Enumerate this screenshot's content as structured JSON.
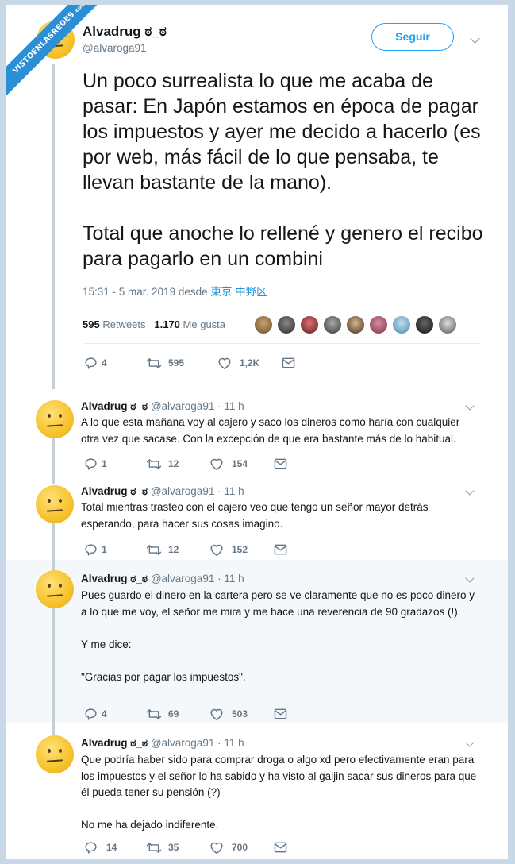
{
  "watermark": {
    "text": "VISTOENLASREDES",
    "suffix": ".com"
  },
  "main": {
    "name": "Alvadrug ಠ_ಠ",
    "handle": "@alvaroga91",
    "follow_label": "Seguir",
    "text": "Un poco surrealista lo que me acaba de pasar: En Japón estamos en época de pagar los impuestos y ayer me decido a hacerlo (es por web, más fácil de lo que pensaba, te llevan bastante de la mano).\n\nTotal que anoche lo rellené y genero el recibo para pagarlo en un combini",
    "time": "15:31 - 5 mar. 2019 desde",
    "location": "東京 中野区",
    "retweets_count": "595",
    "retweets_label": "Retweets",
    "likes_count": "1.170",
    "likes_label": "Me gusta",
    "actions": {
      "replies": "4",
      "retweets": "595",
      "likes": "1,2K"
    }
  },
  "replies": [
    {
      "name": "Alvadrug ಠ_ಠ",
      "handle": "@alvaroga91",
      "time": "· 11 h",
      "text": "A lo que esta mañana voy al cajero y saco los dineros como haría con cualquier otra vez que sacase. Con la excepción de que era bastante más de lo habitual.",
      "replies": "1",
      "retweets": "12",
      "likes": "154"
    },
    {
      "name": "Alvadrug ಠ_ಠ",
      "handle": "@alvaroga91",
      "time": "· 11 h",
      "text": "Total mientras trasteo con el cajero veo que tengo un señor mayor detrás esperando, para hacer sus cosas imagino.",
      "replies": "1",
      "retweets": "12",
      "likes": "152"
    },
    {
      "name": "Alvadrug ಠ_ಠ",
      "handle": "@alvaroga91",
      "time": "· 11 h",
      "text": "Pues guardo el dinero en la cartera pero se ve claramente que no es poco dinero y a lo que me voy, el señor me mira y me hace una reverencia de 90 gradazos (!).\n\nY me dice:\n\n\"Gracias por pagar los impuestos\".",
      "replies": "4",
      "retweets": "69",
      "likes": "503"
    },
    {
      "name": "Alvadrug ಠ_ಠ",
      "handle": "@alvaroga91",
      "time": "· 11 h",
      "text": "Que podría haber sido para comprar droga o algo xd pero efectivamente eran para los impuestos y el señor lo ha sabido y ha visto al gaijin sacar sus dineros para que él pueda tener su pensión (?)\n\nNo me ha dejado indiferente.",
      "replies": "14",
      "retweets": "35",
      "likes": "700"
    }
  ],
  "colors": {
    "accent": "#1da1f2",
    "muted": "#657786",
    "text": "#14171a",
    "highlight": "#f5f8fa"
  }
}
